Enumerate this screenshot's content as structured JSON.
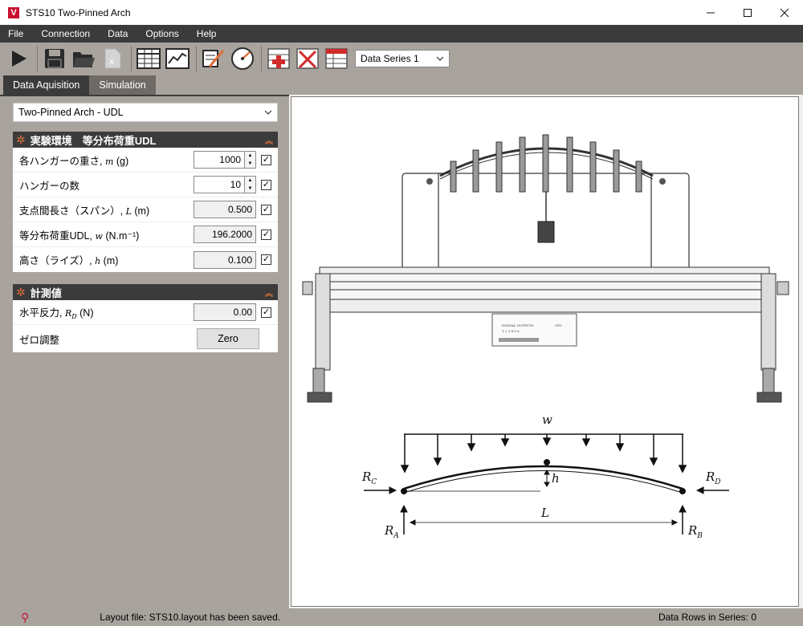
{
  "window": {
    "title": "STS10 Two-Pinned Arch",
    "app_icon_letter": "V"
  },
  "menu": [
    {
      "label": "File"
    },
    {
      "label": "Connection"
    },
    {
      "label": "Data"
    },
    {
      "label": "Options"
    },
    {
      "label": "Help"
    }
  ],
  "toolbar": {
    "icons": [
      "play-icon",
      "save-icon",
      "open-folder-icon",
      "export-excel-icon",
      "table-icon",
      "graph-icon",
      "edit-chart-icon",
      "gauge-icon",
      "add-row-icon",
      "delete-icon",
      "clear-table-icon"
    ],
    "series_select": "Data Series 1"
  },
  "tabs": [
    {
      "label": "Data Aquisition",
      "active": true
    },
    {
      "label": "Simulation",
      "active": false
    }
  ],
  "experiment_select": "Two-Pinned Arch - UDL",
  "setup": {
    "header": "実験環境　等分布荷重UDL",
    "rows": [
      {
        "label": "各ハンガーの重さ, ",
        "sym": "m",
        "unit": " (g)",
        "value": "1000",
        "spin": true,
        "checked": true,
        "readonly": false
      },
      {
        "label": "ハンガーの数",
        "sym": "",
        "unit": "",
        "value": "10",
        "spin": true,
        "checked": true,
        "readonly": false
      },
      {
        "label": "支点間長さ（スパン）, ",
        "sym": "L",
        "unit": " (m)",
        "value": "0.500",
        "spin": false,
        "checked": true,
        "readonly": true
      },
      {
        "label": "等分布荷重UDL, ",
        "sym": "w",
        "unit": " (N.m⁻¹)",
        "value": "196.2000",
        "spin": false,
        "checked": true,
        "readonly": true
      },
      {
        "label": "高さ（ライズ）, ",
        "sym": "h",
        "unit": " (m)",
        "value": "0.100",
        "spin": false,
        "checked": true,
        "readonly": true
      }
    ]
  },
  "measure": {
    "header": "計測値",
    "rows": [
      {
        "label": "水平反力, ",
        "sym": "R_D",
        "unit": " (N)",
        "value": "0.00",
        "checked": true
      }
    ],
    "zero_label": "ゼロ調整",
    "zero_button": "Zero"
  },
  "diagram": {
    "load_label": "w",
    "rise_label": "h",
    "span_label": "L",
    "reaction_c": "R",
    "reaction_c_sub": "C",
    "reaction_d": "R",
    "reaction_d_sub": "D",
    "reaction_a": "R",
    "reaction_a_sub": "A",
    "reaction_b": "R",
    "reaction_b_sub": "B",
    "panel_caption": "DIGITAL OUTPUTS",
    "panel_numbers": "1  2  3  4  5  6",
    "panel_cpu": "CPU"
  },
  "status": {
    "message": "Layout file: STS10.layout has been saved.",
    "rows": "Data Rows in Series: 0"
  },
  "colors": {
    "accent": "#e06f3a",
    "dark": "#3b3b3b",
    "panel": "#a9a39e",
    "brand": "#c8102e"
  }
}
